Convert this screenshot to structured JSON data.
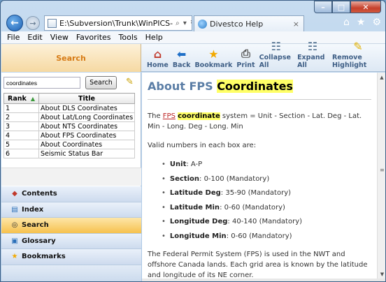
{
  "browser": {
    "address": "E:\\Subversion\\Trunk\\WinPICS-",
    "address_controls": "⌕ ▾ ↻ ✕",
    "tab_title": "Divestco Help",
    "tab_close": "×"
  },
  "window_controls": {
    "min": "–",
    "max": "□",
    "close": "✕"
  },
  "menu": [
    "File",
    "Edit",
    "View",
    "Favorites",
    "Tools",
    "Help"
  ],
  "toolbar": {
    "pane_title": "Search",
    "tools": [
      {
        "label": "Home",
        "icon": "home-icon",
        "glyph": "⌂"
      },
      {
        "label": "Back",
        "icon": "back-arrow-icon",
        "glyph": "⬅"
      },
      {
        "label": "Bookmark",
        "icon": "star-icon",
        "glyph": "★"
      },
      {
        "label": "Print",
        "icon": "printer-icon",
        "glyph": "⎙"
      },
      {
        "label": "Collapse All",
        "icon": "collapse-tree-icon",
        "glyph": "☷"
      },
      {
        "label": "Expand All",
        "icon": "expand-tree-icon",
        "glyph": "☷"
      },
      {
        "label": "Remove Highlight",
        "icon": "highlighter-icon",
        "glyph": "✎"
      }
    ]
  },
  "search": {
    "query": "coordinates",
    "button": "Search",
    "columns": [
      "Rank",
      "Title"
    ],
    "results": [
      {
        "rank": "1",
        "title": "About DLS Coordinates"
      },
      {
        "rank": "2",
        "title": "About Lat/Long Coordinates"
      },
      {
        "rank": "3",
        "title": "About NTS Coordinates"
      },
      {
        "rank": "4",
        "title": "About FPS Coordinates"
      },
      {
        "rank": "5",
        "title": "About Coordinates"
      },
      {
        "rank": "6",
        "title": "Seismic Status Bar"
      }
    ]
  },
  "panes": [
    {
      "label": "Contents",
      "icon": "book-icon",
      "glyph": "◆",
      "active": false
    },
    {
      "label": "Index",
      "icon": "index-icon",
      "glyph": "▤",
      "active": false
    },
    {
      "label": "Search",
      "icon": "binoculars-icon",
      "glyph": "◎",
      "active": true
    },
    {
      "label": "Glossary",
      "icon": "glossary-icon",
      "glyph": "▣",
      "active": false
    },
    {
      "label": "Bookmarks",
      "icon": "star-icon",
      "glyph": "★",
      "active": false
    }
  ],
  "article": {
    "title_plain": "About FPS ",
    "title_hit": "Coordinates",
    "intro_link": "FPS",
    "intro_hit": "coordinate",
    "intro_rest": " system = Unit - Section - Lat. Deg - Lat. Min - Long. Deg - Long. Min",
    "valid_text": "Valid numbers in each box are:",
    "fields": [
      {
        "name": "Unit",
        "value": ": A-P"
      },
      {
        "name": "Section",
        "value": ": 0-100 (Mandatory)"
      },
      {
        "name": "Latitude Deg",
        "value": ": 35-90 (Mandatory)"
      },
      {
        "name": "Latitude Min",
        "value": ": 0-60 (Mandatory)"
      },
      {
        "name": "Longitude Deg",
        "value": ": 40-140 (Mandatory)"
      },
      {
        "name": "Longitude Min",
        "value": ": 0-60 (Mandatory)"
      }
    ],
    "footer": "The Federal Permit System (FPS) is used in the NWT and offshore Canada lands. Each grid area is known by the latitude and longitude of its NE corner."
  },
  "colors": {
    "accent": "#d67a14",
    "title": "#5b7ea6",
    "highlight": "#ffff66",
    "link": "#b22222"
  }
}
